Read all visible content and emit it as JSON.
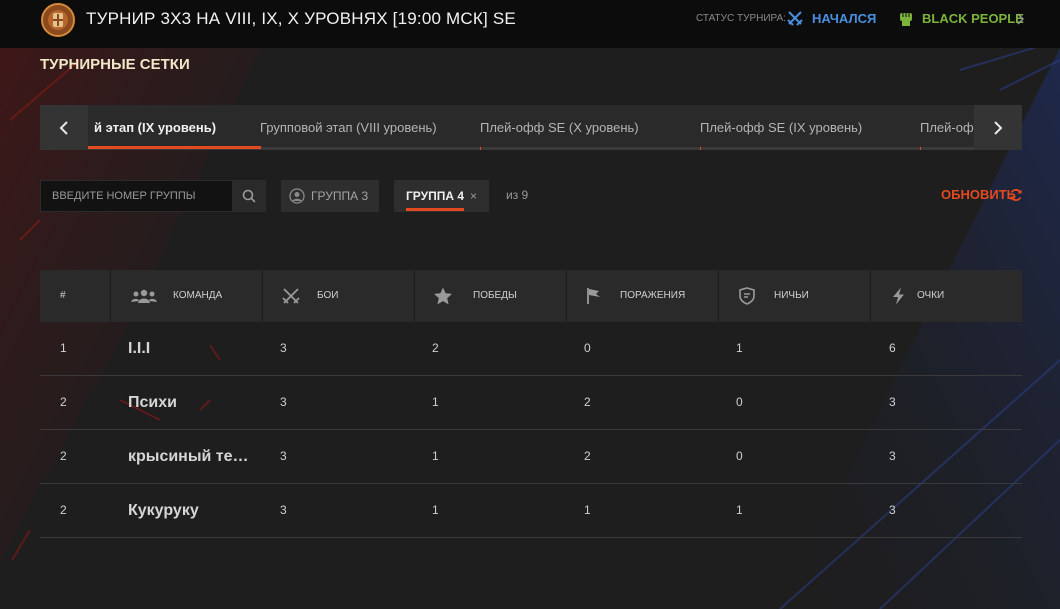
{
  "header": {
    "title": "ТУРНИР 3Х3 НА VIII, IX, X УРОВНЯХ [19:00 МСК] SE",
    "status_label": "СТАТУС ТУРНИРА:",
    "status_value": "НАЧАЛСЯ",
    "team_name": "BLACK PEOPLE",
    "colors": {
      "status": "#4a8fe0",
      "team": "#7bb33a",
      "accent": "#e34a20"
    }
  },
  "section_title": "ТУРНИРНЫЕ СЕТКИ",
  "tabs": [
    {
      "label": "й этап (IX уровень)",
      "active": true
    },
    {
      "label": "Групповой этап (VIII уровень)",
      "active": false
    },
    {
      "label": "Плей-офф SE (X уровень)",
      "active": false
    },
    {
      "label": "Плей-офф SE (IX уровень)",
      "active": false
    },
    {
      "label": "Плей-оф",
      "active": false
    }
  ],
  "filters": {
    "search_placeholder": "Введите номер группы",
    "group3_label": "ГРУППА 3",
    "group4_label": "ГРУППА 4",
    "group4_close": "×",
    "of_total": "из 9",
    "refresh_label": "ОБНОВИТЬ"
  },
  "table": {
    "headers": {
      "rank": "#",
      "team": "КОМАНДА",
      "battles": "БОИ",
      "wins": "ПОБЕДЫ",
      "losses": "ПОРАЖЕНИЯ",
      "draws": "НИЧЬИ",
      "points": "ОЧКИ"
    },
    "rows": [
      {
        "rank": "1",
        "team": "I.I.I",
        "battles": "3",
        "wins": "2",
        "losses": "0",
        "draws": "1",
        "points": "6"
      },
      {
        "rank": "2",
        "team": "Психи",
        "battles": "3",
        "wins": "1",
        "losses": "2",
        "draws": "0",
        "points": "3"
      },
      {
        "rank": "2",
        "team": "крысиный те…",
        "battles": "3",
        "wins": "1",
        "losses": "2",
        "draws": "0",
        "points": "3"
      },
      {
        "rank": "2",
        "team": "Кукуруку",
        "battles": "3",
        "wins": "1",
        "losses": "1",
        "draws": "1",
        "points": "3"
      }
    ]
  },
  "icons": {
    "logo": "tournament-emblem-icon",
    "status": "crossed-swords-icon",
    "team": "fist-icon",
    "search": "search-icon",
    "refresh": "refresh-icon"
  }
}
